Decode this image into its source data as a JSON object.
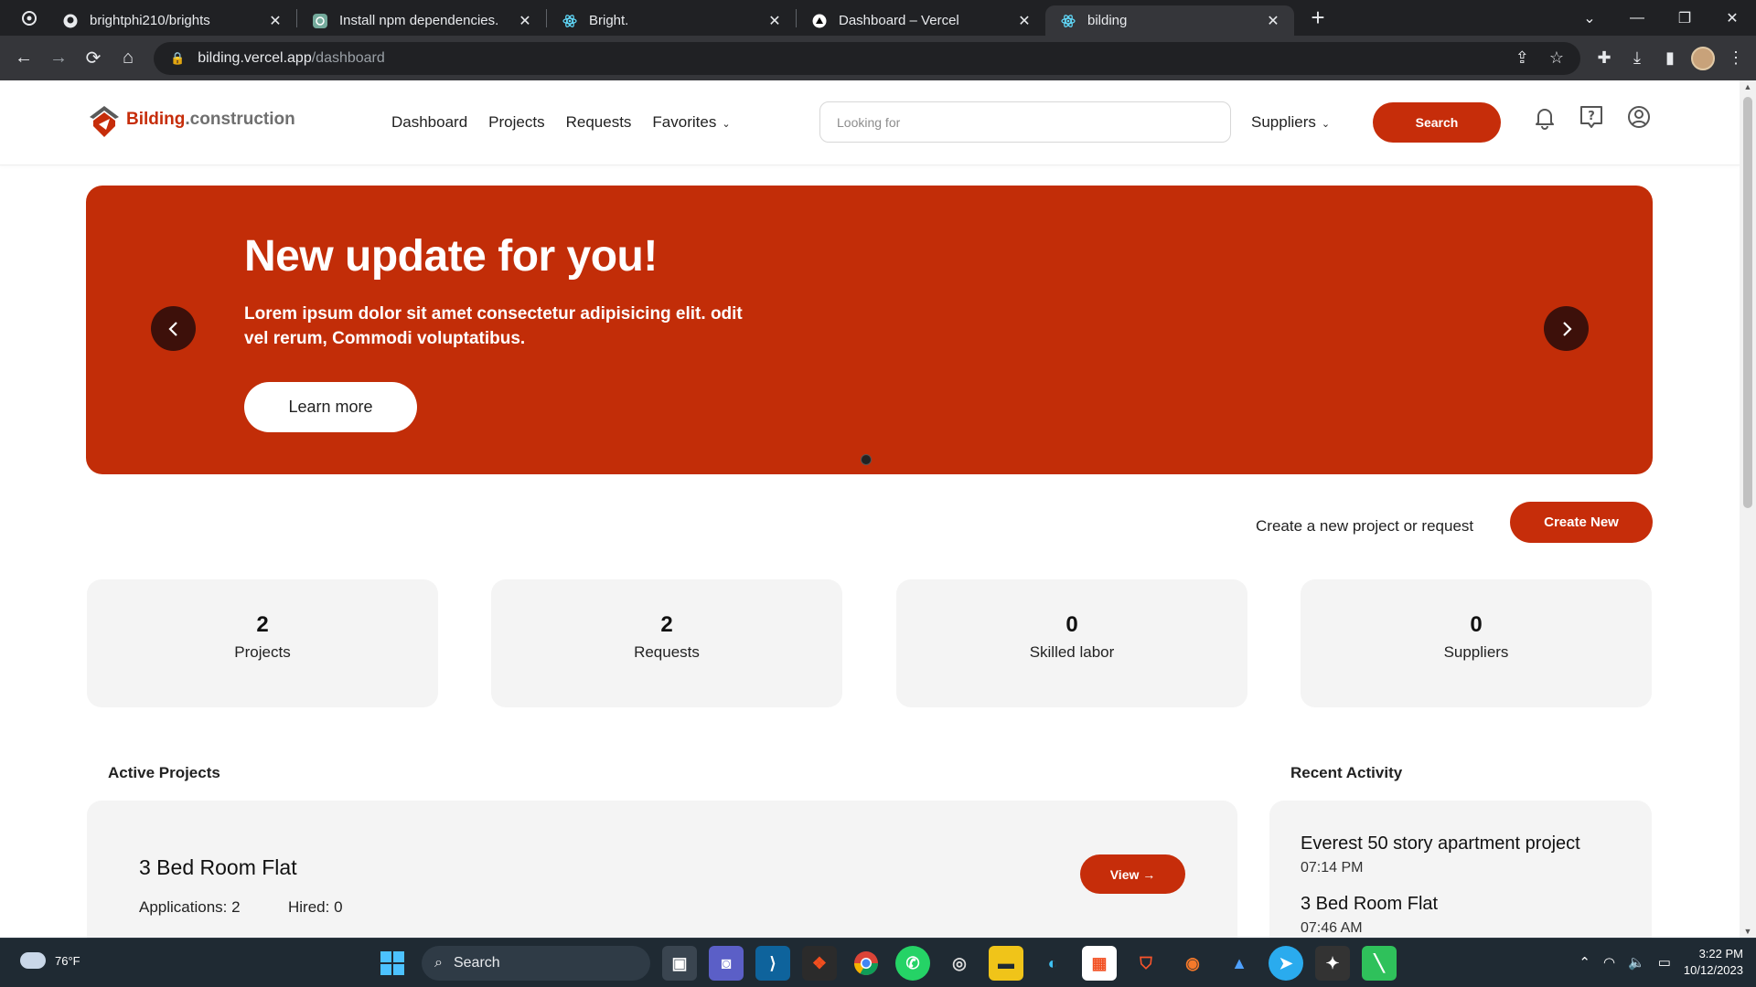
{
  "browser": {
    "tabs": [
      {
        "title": "brightphi210/brights",
        "icon": "github-icon"
      },
      {
        "title": "Install npm dependencies.",
        "icon": "chatgpt-icon"
      },
      {
        "title": "Bright.",
        "icon": "react-icon"
      },
      {
        "title": "Dashboard – Vercel",
        "icon": "vercel-icon"
      },
      {
        "title": "bilding",
        "icon": "react-icon",
        "active": true
      }
    ],
    "new_tab_label": "+",
    "url_host": "bilding.vercel.app",
    "url_path": "/dashboard"
  },
  "nav": {
    "logo_brand": "Bilding",
    "logo_suffix": ".construction",
    "items": [
      "Dashboard",
      "Projects",
      "Requests",
      "Favorites"
    ],
    "search_placeholder": "Looking for",
    "suppliers_label": "Suppliers",
    "search_button": "Search"
  },
  "hero": {
    "title": "New update for you!",
    "text": "Lorem ipsum dolor sit amet consectetur adipisicing elit. odit vel rerum, Commodi voluptatibus.",
    "button": "Learn more"
  },
  "cta": {
    "text": "Create a new project or request",
    "button": "Create New"
  },
  "stats": [
    {
      "value": "2",
      "label": "Projects"
    },
    {
      "value": "2",
      "label": "Requests"
    },
    {
      "value": "0",
      "label": "Skilled labor"
    },
    {
      "value": "0",
      "label": "Suppliers"
    }
  ],
  "active_projects": {
    "title": "Active Projects",
    "project": {
      "name": "3 Bed Room Flat",
      "applications": "Applications: 2",
      "hired": "Hired: 0",
      "view_button": "View →"
    }
  },
  "recent_activity": {
    "title": "Recent Activity",
    "items": [
      {
        "name": "Everest 50 story apartment project",
        "time": "07:14 PM"
      },
      {
        "name": "3 Bed Room Flat",
        "time": "07:46 AM"
      }
    ]
  },
  "taskbar": {
    "weather": "76°F",
    "search": "Search",
    "time": "3:22 PM",
    "date": "10/12/2023"
  },
  "colors": {
    "brand_red": "#c62d0a",
    "hero_bg": "#c22d08",
    "card_bg": "#f4f4f4"
  }
}
